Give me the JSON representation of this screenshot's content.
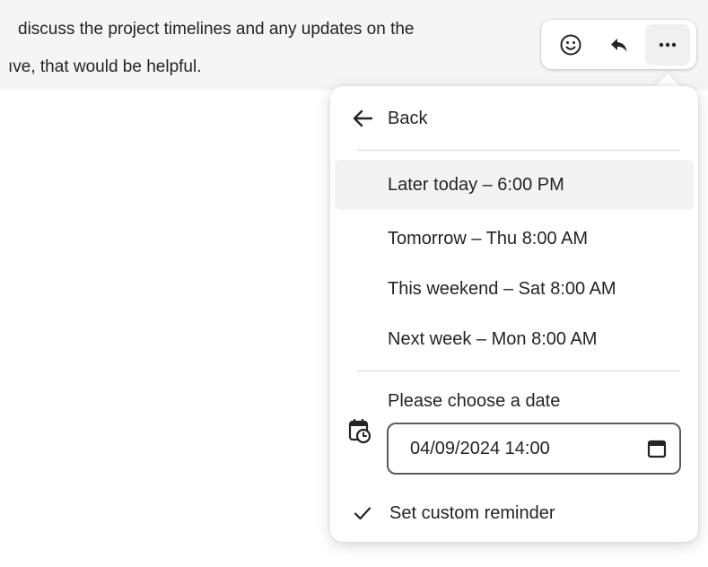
{
  "message": {
    "line1": "discuss the project timelines and any updates on the",
    "line2": "ıve, that would be helpful."
  },
  "toolbar": {
    "buttons": [
      {
        "icon": "emoji-smile-icon"
      },
      {
        "icon": "reply-icon"
      },
      {
        "icon": "more-options-icon",
        "active": true
      }
    ]
  },
  "menu": {
    "back_label": "Back",
    "options": [
      {
        "label": "Later today – 6:00 PM",
        "highlighted": true
      },
      {
        "label": "Tomorrow – Thu 8:00 AM"
      },
      {
        "label": "This weekend – Sat 8:00 AM"
      },
      {
        "label": "Next week – Mon 8:00 AM"
      }
    ],
    "date_prompt": "Please choose a date",
    "date_value": "04/09/2024 14:00",
    "custom_label": "Set custom reminder"
  },
  "colors": {
    "text": "#242424",
    "band": "#f5f5f5",
    "highlight": "#f3f3f3",
    "divider": "#d6d6d6"
  }
}
